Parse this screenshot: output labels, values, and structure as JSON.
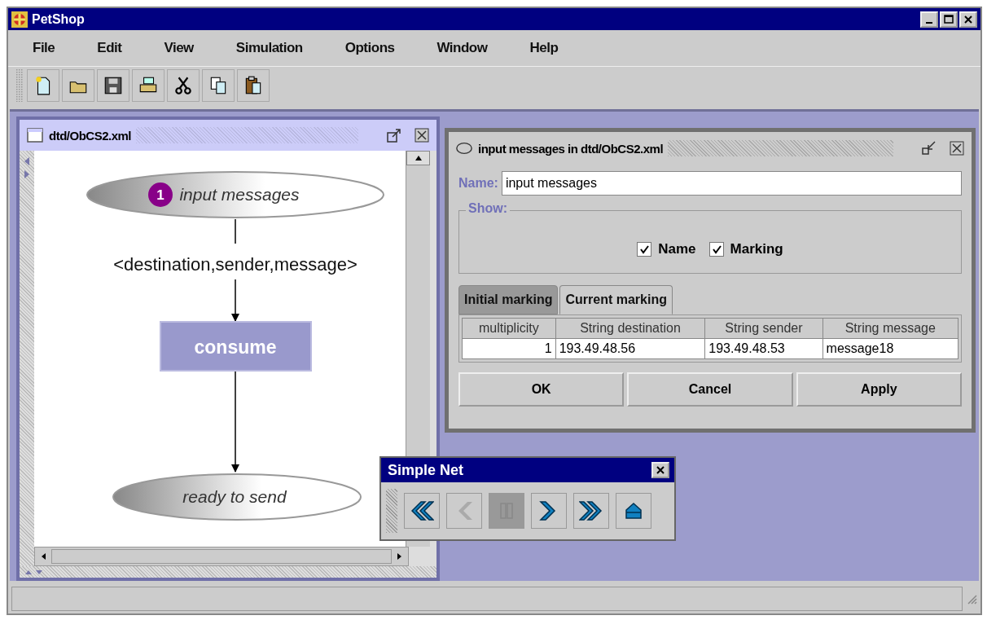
{
  "window": {
    "title": "PetShop"
  },
  "menu": [
    {
      "label": "File"
    },
    {
      "label": "Edit"
    },
    {
      "label": "View"
    },
    {
      "label": "Simulation"
    },
    {
      "label": "Options"
    },
    {
      "label": "Window"
    },
    {
      "label": "Help"
    }
  ],
  "toolbar": [
    {
      "kind": "new"
    },
    {
      "kind": "open"
    },
    {
      "kind": "save"
    },
    {
      "kind": "print"
    },
    {
      "kind": "cut"
    },
    {
      "kind": "copy"
    },
    {
      "kind": "paste"
    }
  ],
  "net_frame": {
    "title": "dtd/ObCS2.xml",
    "places": [
      {
        "label": "input messages",
        "marking": "1"
      },
      {
        "label": "ready to send"
      }
    ],
    "arc_label": "<destination,sender,message>",
    "transition": {
      "label": "consume"
    }
  },
  "dialog": {
    "title": "input messages in dtd/ObCS2.xml",
    "name_label": "Name:",
    "name_value": "input messages",
    "show_label": "Show:",
    "checkboxes": [
      {
        "label": "Name",
        "checked": true
      },
      {
        "label": "Marking",
        "checked": true
      }
    ],
    "tabs": [
      {
        "label": "Initial marking",
        "selected": false
      },
      {
        "label": "Current marking",
        "selected": true
      }
    ],
    "table": {
      "columns": [
        "multiplicity",
        "String destination",
        "String sender",
        "String message"
      ],
      "rows": [
        [
          "1",
          "193.49.48.56",
          "193.49.48.53",
          "message18"
        ]
      ]
    },
    "buttons": [
      "OK",
      "Cancel",
      "Apply"
    ]
  },
  "simple_net": {
    "title": "Simple Net",
    "buttons": [
      {
        "kind": "fast-back",
        "disabled": false
      },
      {
        "kind": "back",
        "disabled": true
      },
      {
        "kind": "pause",
        "disabled": true
      },
      {
        "kind": "forward",
        "disabled": false
      },
      {
        "kind": "fast-forward",
        "disabled": false
      },
      {
        "kind": "eject",
        "disabled": false
      }
    ]
  }
}
